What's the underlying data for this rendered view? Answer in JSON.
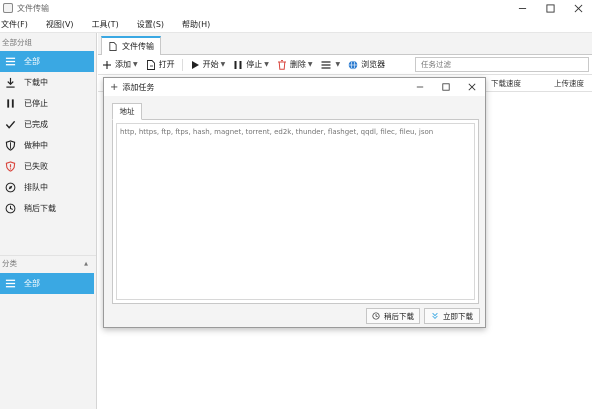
{
  "window": {
    "title": "文件传输"
  },
  "menu": [
    "文件(F)",
    "视图(V)",
    "工具(T)",
    "设置(S)",
    "帮助(H)"
  ],
  "sidebar": {
    "header": "全部分组",
    "items": [
      {
        "label": "全部",
        "icon": "list-icon",
        "active": true
      },
      {
        "label": "下载中",
        "icon": "download-icon",
        "active": false
      },
      {
        "label": "已停止",
        "icon": "pause-icon",
        "active": false
      },
      {
        "label": "已完成",
        "icon": "check-icon",
        "active": false
      },
      {
        "label": "做种中",
        "icon": "shield-icon",
        "active": false
      },
      {
        "label": "已失败",
        "icon": "error-icon",
        "active": false
      },
      {
        "label": "排队中",
        "icon": "compass-icon",
        "active": false
      },
      {
        "label": "稍后下载",
        "icon": "clock-icon",
        "active": false
      }
    ],
    "category_header": "分类",
    "category_collapse": "▲",
    "categories": [
      {
        "label": "全部",
        "icon": "list-icon",
        "active": true
      }
    ]
  },
  "tabs": [
    {
      "label": "文件传输"
    }
  ],
  "toolbar": {
    "add": "添加",
    "open": "打开",
    "start": "开始",
    "stop": "停止",
    "delete": "删除",
    "browser": "浏览器",
    "filter_placeholder": "任务过滤"
  },
  "columns": {
    "download_speed": "下载速度",
    "upload_speed": "上传速度"
  },
  "dialog": {
    "title": "添加任务",
    "tab": "地址",
    "placeholder": "http, https, ftp, ftps, hash, magnet, torrent, ed2k, thunder, flashget, qqdl, filec, fileu, json",
    "later_button": "稍后下载",
    "now_button": "立即下载"
  },
  "colors": {
    "accent": "#3aa8e3",
    "delete_red": "#d9463e",
    "browser_blue": "#2b7bd0"
  }
}
